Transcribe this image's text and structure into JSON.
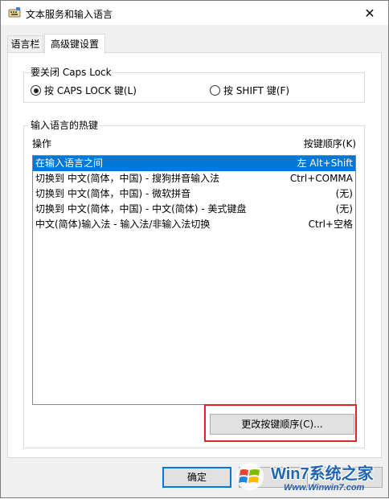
{
  "window": {
    "title": "文本服务和输入语言",
    "close_glyph": "✕"
  },
  "tabs": [
    {
      "label": "语言栏"
    },
    {
      "label": "高级键设置"
    }
  ],
  "caps_group": {
    "title": "要关闭 Caps Lock",
    "options": [
      {
        "label": "按 CAPS LOCK 键(L)",
        "checked": true
      },
      {
        "label": "按 SHIFT 键(F)",
        "checked": false
      }
    ]
  },
  "hotkey_group": {
    "title": "输入语言的热键",
    "col_action": "操作",
    "col_sequence": "按键顺序(K)",
    "rows": [
      {
        "action": "在输入语言之间",
        "keys": "左 Alt+Shift",
        "selected": true
      },
      {
        "action": "切换到 中文(简体，中国) - 搜狗拼音输入法",
        "keys": "Ctrl+COMMA",
        "selected": false
      },
      {
        "action": "切换到 中文(简体，中国) - 微软拼音",
        "keys": "(无)",
        "selected": false
      },
      {
        "action": "切换到 中文(简体，中国) - 中文(简体) - 美式键盘",
        "keys": "(无)",
        "selected": false
      },
      {
        "action": "中文(简体)输入法 - 输入法/非输入法切换",
        "keys": "Ctrl+空格",
        "selected": false
      }
    ],
    "change_button": "更改按键顺序(C)..."
  },
  "footer": {
    "ok": "确定"
  },
  "watermark": {
    "brand": "Win7系统之家",
    "url": "Www.Winwin7.com"
  },
  "colors": {
    "selection": "#0078d7",
    "highlight_outline": "#d7272b"
  }
}
